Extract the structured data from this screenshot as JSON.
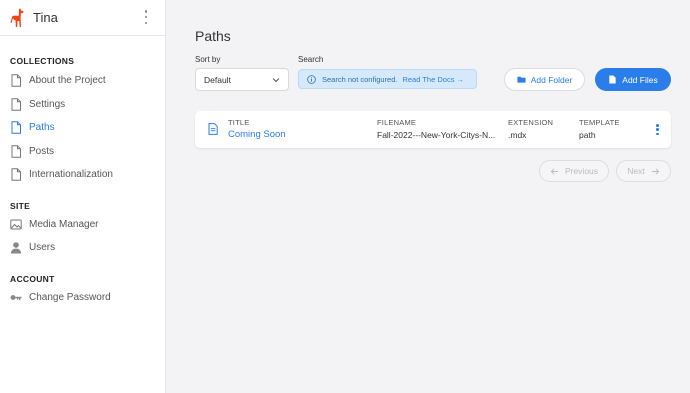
{
  "app": {
    "title": "Tina"
  },
  "sidebar": {
    "collections_heading": "COLLECTIONS",
    "collections": [
      {
        "label": "About the Project",
        "active": false
      },
      {
        "label": "Settings",
        "active": false
      },
      {
        "label": "Paths",
        "active": true
      },
      {
        "label": "Posts",
        "active": false
      },
      {
        "label": "Internationalization",
        "active": false
      }
    ],
    "site_heading": "SITE",
    "site": [
      {
        "label": "Media Manager",
        "icon": "image-icon"
      },
      {
        "label": "Users",
        "icon": "user-icon"
      }
    ],
    "account_heading": "ACCOUNT",
    "account": [
      {
        "label": "Change Password",
        "icon": "key-icon"
      }
    ]
  },
  "main": {
    "title": "Paths",
    "sort": {
      "label": "Sort by",
      "value": "Default"
    },
    "search": {
      "label": "Search",
      "message": "Search not configured.",
      "link": "Read The Docs →"
    },
    "add_folder": "Add Folder",
    "add_files": "Add Files",
    "table": {
      "headers": {
        "title": "TITLE",
        "filename": "FILENAME",
        "extension": "EXTENSION",
        "template": "TEMPLATE"
      },
      "rows": [
        {
          "title": "Coming Soon",
          "filename": "Fall-2022---New-York-Citys-N...",
          "extension": ".mdx",
          "template": "path"
        }
      ]
    },
    "pagination": {
      "previous": "Previous",
      "next": "Next"
    }
  },
  "colors": {
    "accent": "#2b7de9",
    "llama": "#ec4815",
    "background": "#f3f3f6"
  }
}
